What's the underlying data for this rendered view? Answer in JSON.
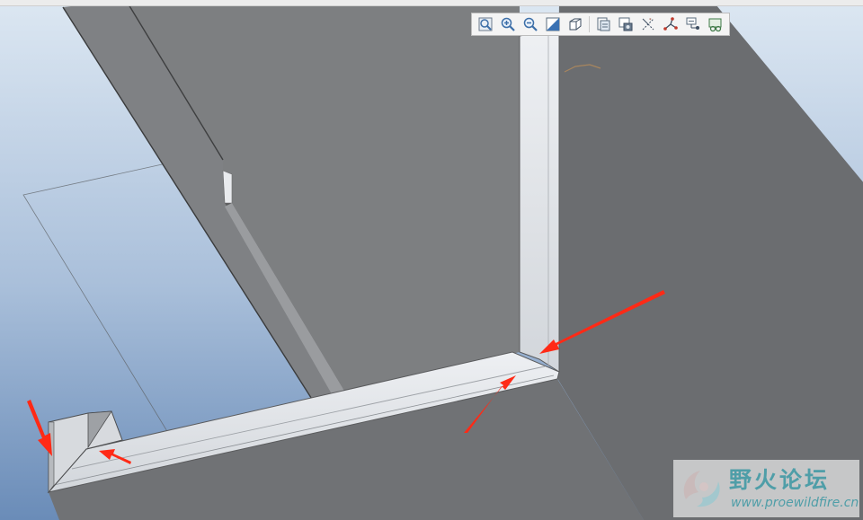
{
  "toolbar": {
    "buttons": [
      {
        "icon": "refit-icon"
      },
      {
        "icon": "zoom-in-icon"
      },
      {
        "icon": "zoom-out-icon"
      },
      {
        "icon": "repaint-icon"
      },
      {
        "icon": "display-style-icon"
      },
      {
        "icon": "saved-views-icon"
      },
      {
        "icon": "view-manager-icon"
      },
      {
        "icon": "datum-planes-icon"
      },
      {
        "icon": "datum-axes-icon"
      },
      {
        "icon": "datum-points-icon"
      },
      {
        "icon": "coordinate-systems-icon"
      }
    ]
  },
  "annotations": {
    "arrow_color": "#ff2a16",
    "arrow_count": 4
  },
  "watermark": {
    "title": "野火论坛",
    "url": "www.proewildfire.cn"
  },
  "colors": {
    "sky_top": "#d8e4f0",
    "sky_bottom": "#6f8fb9",
    "dark_face": "#6b6d70",
    "mid_face": "#7e8082",
    "light_flange": "#e3e6ea",
    "accent": "#4f9ea8"
  }
}
